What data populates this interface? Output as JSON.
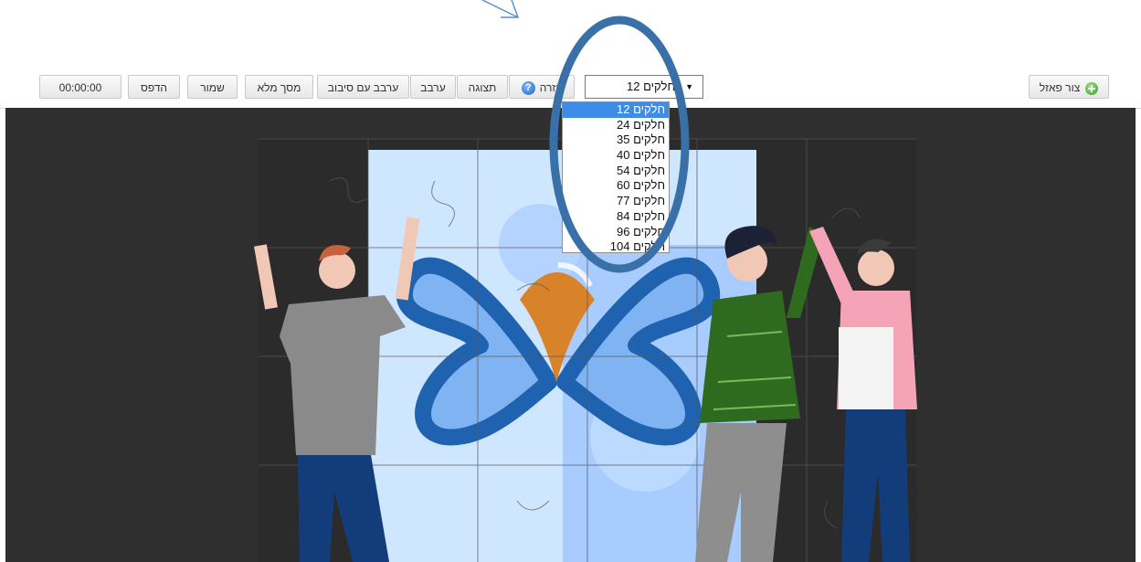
{
  "toolbar": {
    "create_puzzle": "צור פאזל",
    "pieces_selected": "12 חלקים",
    "help": "עזרה",
    "preview": "תצוגה",
    "shuffle": "ערבב",
    "shuffle_rotate": "ערבב עם סיבוב",
    "fullscreen": "מסך מלא",
    "save": "שמור",
    "print": "הדפס",
    "timer": "00:00:00"
  },
  "pieces_options": [
    "12 חלקים",
    "24 חלקים",
    "35 חלקים",
    "40 חלקים",
    "54 חלקים",
    "60 חלקים",
    "77 חלקים",
    "84 חלקים",
    "96 חלקים",
    "104 חלקים"
  ],
  "selected_option_index": 0,
  "colors": {
    "annotation_blue": "#3a70a8",
    "stage_bg": "#2f2f2f",
    "selected_option": "#3d8ce8",
    "puzzle_light": "#cfe6ff",
    "butterfly_blue": "#1f63b0",
    "butterfly_orange": "#d8832a",
    "shirt_gray": "#8a8a8a",
    "sweater_green": "#2f6b1f",
    "jacket_pink": "#f5a3b6"
  },
  "icons": {
    "create_puzzle": "plus-icon",
    "help": "help-icon",
    "select_caret": "caret-down-icon"
  }
}
